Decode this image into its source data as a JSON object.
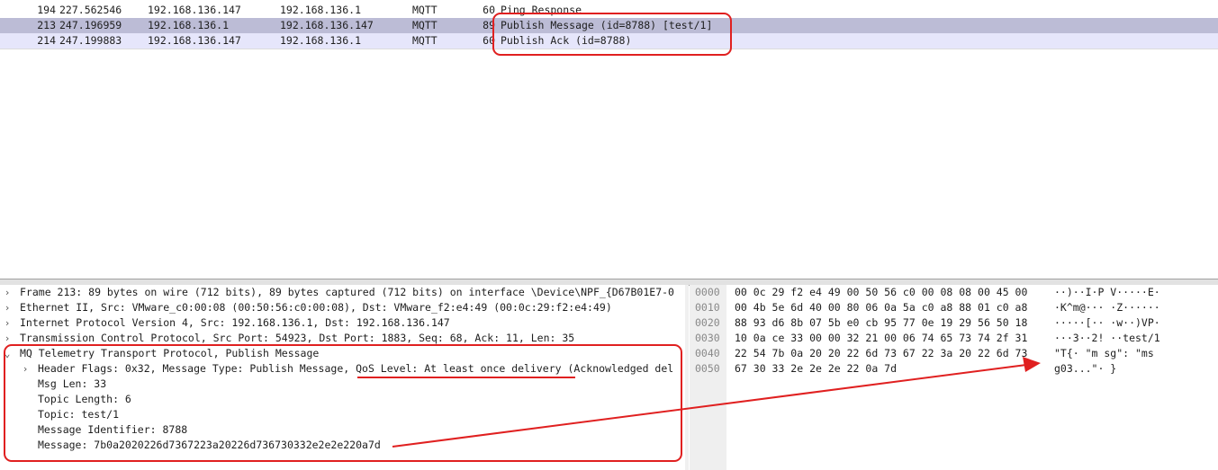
{
  "packet_list": {
    "rows": [
      {
        "no": "194",
        "time": "227.562546",
        "src": "192.168.136.147",
        "dst": "192.168.136.1",
        "proto": "MQTT",
        "len": "60",
        "info": "Ping Response"
      },
      {
        "no": "213",
        "time": "247.196959",
        "src": "192.168.136.1",
        "dst": "192.168.136.147",
        "proto": "MQTT",
        "len": "89",
        "info": "Publish Message (id=8788) [test/1]"
      },
      {
        "no": "214",
        "time": "247.199883",
        "src": "192.168.136.147",
        "dst": "192.168.136.1",
        "proto": "MQTT",
        "len": "60",
        "info": "Publish Ack (id=8788)"
      }
    ]
  },
  "details": {
    "frame": "Frame 213: 89 bytes on wire (712 bits), 89 bytes captured (712 bits) on interface \\Device\\NPF_{D67B01E7-0",
    "ethernet": "Ethernet II, Src: VMware_c0:00:08 (00:50:56:c0:00:08), Dst: VMware_f2:e4:49 (00:0c:29:f2:e4:49)",
    "ip": "Internet Protocol Version 4, Src: 192.168.136.1, Dst: 192.168.136.147",
    "tcp": "Transmission Control Protocol, Src Port: 54923, Dst Port: 1883, Seq: 68, Ack: 11, Len: 35",
    "mqtt": "MQ Telemetry Transport Protocol, Publish Message",
    "header_flags": "Header Flags: 0x32, Message Type: Publish Message, QoS Level: At least once delivery (Acknowledged del",
    "msg_len": "Msg Len: 33",
    "topic_length": "Topic Length: 6",
    "topic": "Topic: test/1",
    "message_identifier": "Message Identifier: 8788",
    "message": "Message: 7b0a2020226d7367223a20226d736730332e2e2e220a7d"
  },
  "bytes": {
    "rows": [
      {
        "offset": "0000",
        "hex": "00 0c 29 f2 e4 49 00 50  56 c0 00 08 08 00 45 00",
        "ascii": "··)··I·P V·····E·"
      },
      {
        "offset": "0010",
        "hex": "00 4b 5e 6d 40 00 80 06  0a 5a c0 a8 88 01 c0 a8",
        "ascii": "·K^m@··· ·Z······"
      },
      {
        "offset": "0020",
        "hex": "88 93 d6 8b 07 5b e0 cb  95 77 0e 19 29 56 50 18",
        "ascii": "·····[·· ·w··)VP·"
      },
      {
        "offset": "0030",
        "hex": "10 0a ce 33 00 00 32 21  00 06 74 65 73 74 2f 31",
        "ascii": "···3··2! ··test/1"
      },
      {
        "offset": "0040",
        "hex": "22 54 7b 0a 20 20 22 6d  73 67 22 3a 20 22 6d 73",
        "ascii": "\"T{·  \"m sg\": \"ms"
      },
      {
        "offset": "0050",
        "hex": "67 30 33 2e 2e 2e 22 0a  7d",
        "ascii": "g03...\"· }"
      }
    ]
  },
  "colors": {
    "selected_row": "#bcbcd6",
    "related_row": "#e6e6fb",
    "annotation": "#e02020"
  }
}
